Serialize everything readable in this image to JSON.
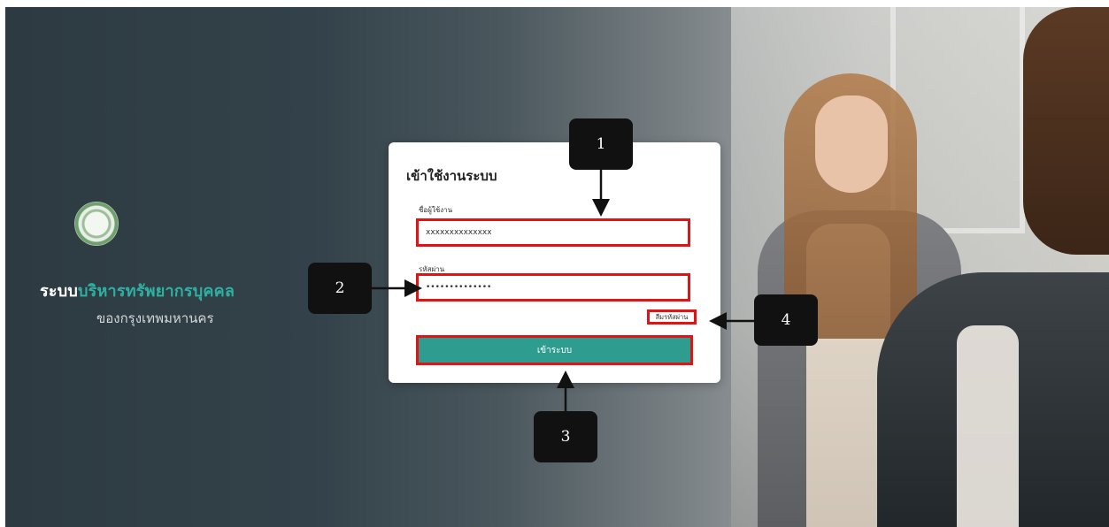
{
  "brand": {
    "title_part1": "ระบบ",
    "title_part2": "บริหารทรัพยากรบุคคล",
    "subtitle": "ของกรุงเทพมหานคร"
  },
  "login": {
    "title": "เข้าใช้งานระบบ",
    "username_label": "ชื่อผู้ใช้งาน",
    "username_value": "xxxxxxxxxxxxxx",
    "password_label": "รหัสผ่าน",
    "password_value": "••••••••••••••",
    "forgot_password": "ลืมรหัสผ่าน",
    "submit": "เข้าระบบ"
  },
  "callouts": {
    "c1": "1",
    "c2": "2",
    "c3": "3",
    "c4": "4"
  },
  "colors": {
    "accent": "#2eb0a2",
    "button": "#2f9c90",
    "highlight": "#e01414"
  }
}
